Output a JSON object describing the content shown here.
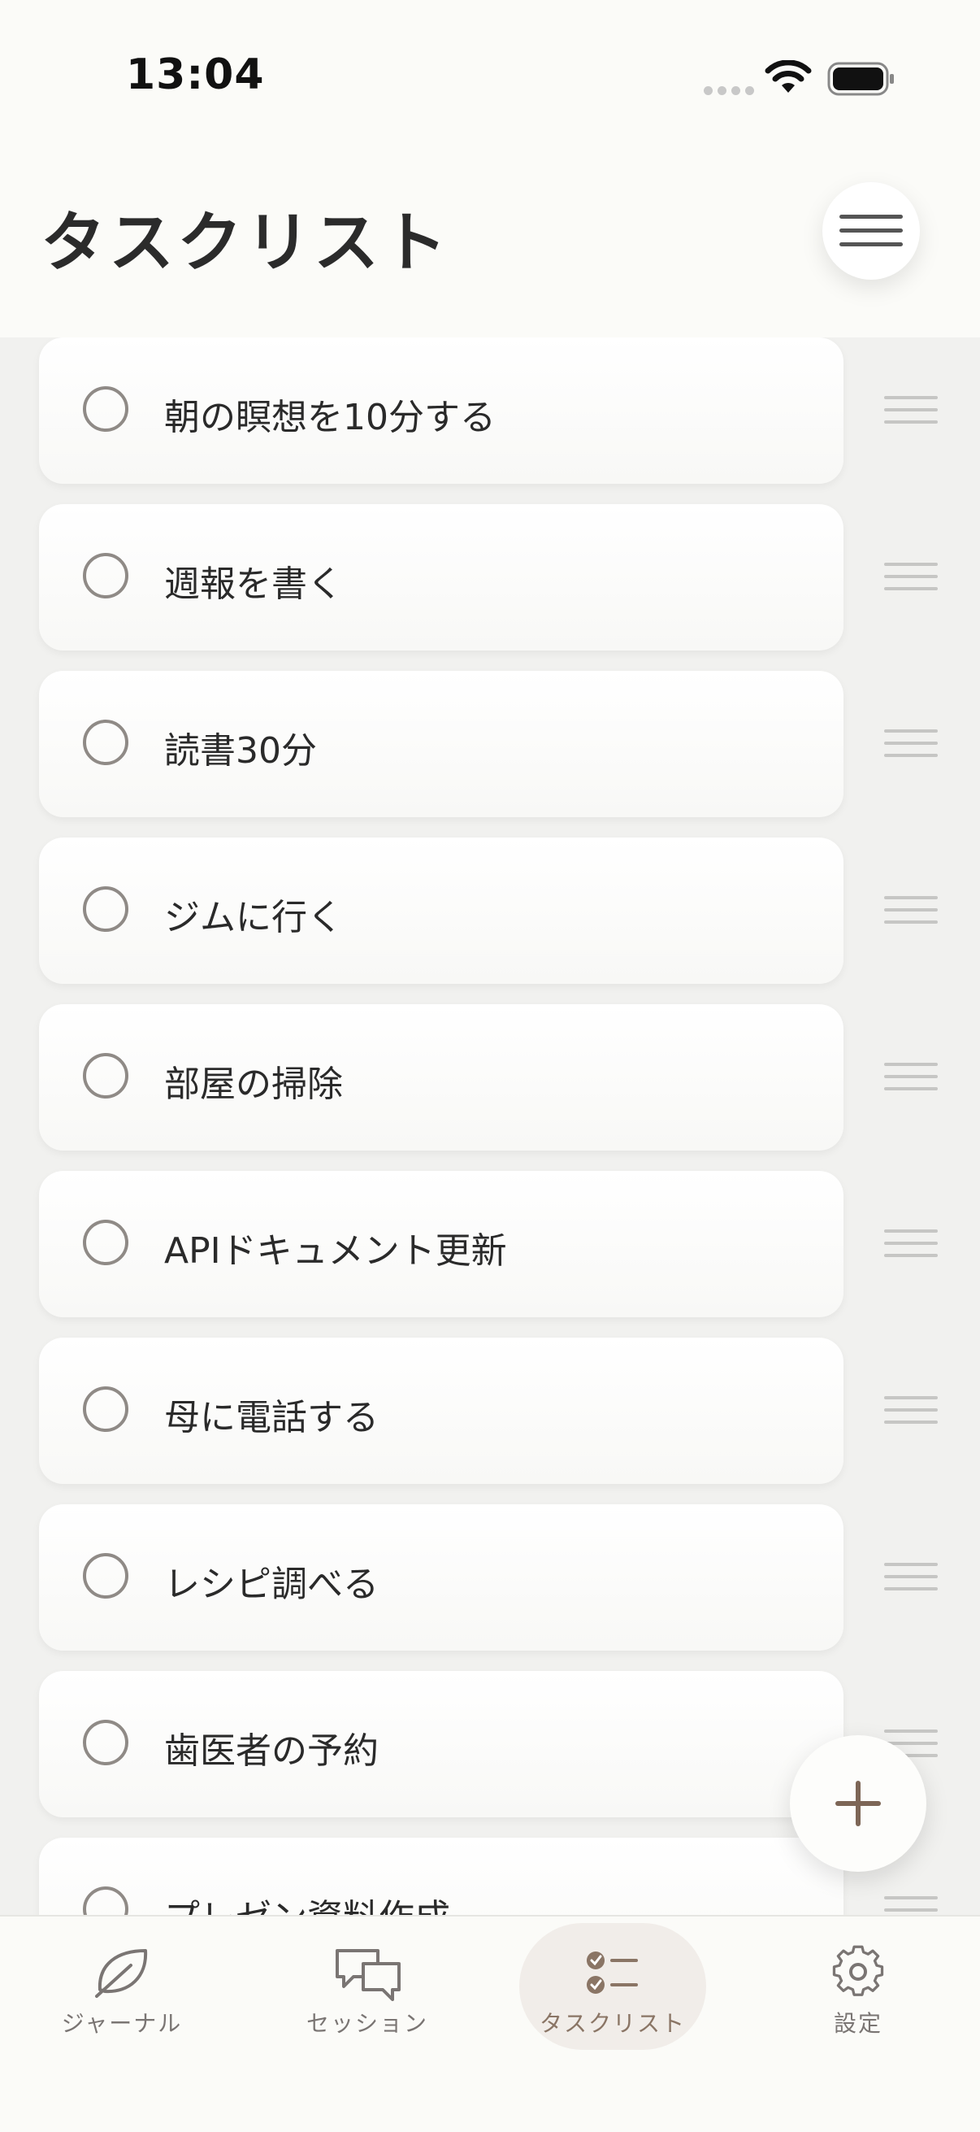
{
  "status_bar": {
    "time": "13:04"
  },
  "header": {
    "title": "タスクリスト"
  },
  "tasks": [
    {
      "label": "朝の瞑想を10分する"
    },
    {
      "label": "週報を書く"
    },
    {
      "label": "読書30分"
    },
    {
      "label": "ジムに行く"
    },
    {
      "label": "部屋の掃除"
    },
    {
      "label": "APIドキュメント更新"
    },
    {
      "label": "母に電話する"
    },
    {
      "label": "レシピ調べる"
    },
    {
      "label": "歯医者の予約"
    },
    {
      "label": "プレゼン資料作成"
    }
  ],
  "tab_bar": {
    "tabs": [
      {
        "label": "ジャーナル",
        "icon": "leaf-icon"
      },
      {
        "label": "セッション",
        "icon": "chat-bubbles-icon"
      },
      {
        "label": "タスクリスト",
        "icon": "checklist-icon",
        "active": true
      },
      {
        "label": "設定",
        "icon": "gear-icon"
      }
    ]
  },
  "colors": {
    "background": "#fbfbf8",
    "card": "#ffffff",
    "accent": "#8a7565",
    "checkbox_border": "#8f8a86"
  }
}
